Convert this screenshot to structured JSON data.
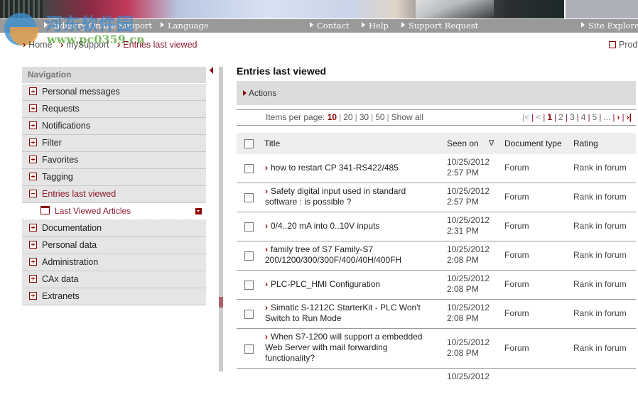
{
  "header": {
    "nav_items": [
      {
        "label": "Industry Online Support"
      },
      {
        "label": "Language"
      },
      {
        "label": "Contact"
      },
      {
        "label": "Help"
      },
      {
        "label": "Support Request"
      },
      {
        "label": "Site Explorer"
      }
    ],
    "watermark_text": "河东软件园",
    "watermark_url": "www.pc0359.cn"
  },
  "breadcrumb": [
    {
      "label": "Home"
    },
    {
      "label": "mySupport"
    },
    {
      "label": "Entries last viewed"
    }
  ],
  "product_link": "Produ",
  "sidebar": {
    "heading": "Navigation",
    "items": [
      {
        "label": "Personal messages",
        "expanded": false
      },
      {
        "label": "Requests",
        "expanded": false
      },
      {
        "label": "Notifications",
        "expanded": false
      },
      {
        "label": "Filter",
        "expanded": false
      },
      {
        "label": "Favorites",
        "expanded": false
      },
      {
        "label": "Tagging",
        "expanded": false
      },
      {
        "label": "Entries last viewed",
        "expanded": true,
        "active": true
      },
      {
        "label": "Documentation",
        "expanded": false
      },
      {
        "label": "Personal data",
        "expanded": false
      },
      {
        "label": "Administration",
        "expanded": false
      },
      {
        "label": "CAx data",
        "expanded": false
      },
      {
        "label": "Extranets",
        "expanded": false
      }
    ],
    "subitem": {
      "label": "Last Viewed Articles"
    }
  },
  "main": {
    "title": "Entries last viewed",
    "actions_label": "Actions",
    "items_per_page": {
      "label": "Items per page:",
      "options": [
        "10",
        "20",
        "30",
        "50",
        "Show all"
      ],
      "selected": "10"
    },
    "pagination": {
      "first": "K",
      "prev": "<",
      "pages": [
        "1",
        "2",
        "3",
        "4",
        "5",
        "..."
      ],
      "current": "1",
      "next": ">",
      "last": ">I"
    },
    "columns": {
      "title": "Title",
      "seen_on": "Seen on",
      "sort_indicator": "∇",
      "document_type": "Document type",
      "rating": "Rating"
    },
    "rows": [
      {
        "title": "how to restart CP 341-RS422/485",
        "date": "10/25/2012",
        "time": "2:57 PM",
        "type": "Forum",
        "rating": "Rank in forum"
      },
      {
        "title": "Safety digital input used in standard software : is possible ?",
        "date": "10/25/2012",
        "time": "2:57 PM",
        "type": "Forum",
        "rating": "Rank in forum"
      },
      {
        "title": "0/4..20 mA into 0..10V inputs",
        "date": "10/25/2012",
        "time": "2:31 PM",
        "type": "Forum",
        "rating": "Rank in forum"
      },
      {
        "title": "family tree of S7 Family-S7 200/1200/300/300F/400/40H/400FH",
        "date": "10/25/2012",
        "time": "2:08 PM",
        "type": "Forum",
        "rating": "Rank in forum"
      },
      {
        "title": "PLC-PLC_HMI Configuration",
        "date": "10/25/2012",
        "time": "2:08 PM",
        "type": "Forum",
        "rating": "Rank in forum"
      },
      {
        "title": "Simatic S-1212C StarterKit - PLC Won't Switch to Run Mode",
        "date": "10/25/2012",
        "time": "2:08 PM",
        "type": "Forum",
        "rating": "Rank in forum"
      },
      {
        "title": "When S7-1200 will support a embedded Web Server with mail forwarding functionality?",
        "date": "10/25/2012",
        "time": "2:08 PM",
        "type": "Forum",
        "rating": "Rank in forum"
      }
    ],
    "partial_row_date": "10/25/2012"
  }
}
